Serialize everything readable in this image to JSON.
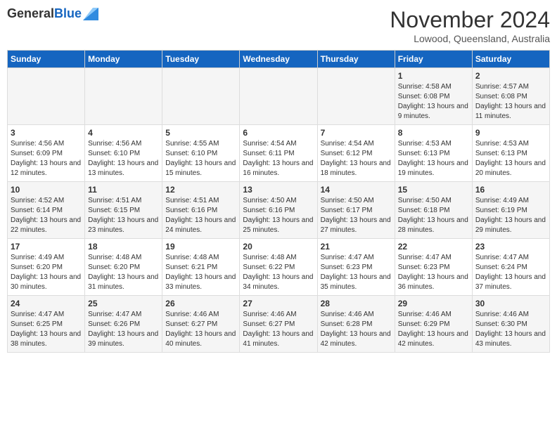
{
  "header": {
    "logo_general": "General",
    "logo_blue": "Blue",
    "month_title": "November 2024",
    "location": "Lowood, Queensland, Australia"
  },
  "weekdays": [
    "Sunday",
    "Monday",
    "Tuesday",
    "Wednesday",
    "Thursday",
    "Friday",
    "Saturday"
  ],
  "weeks": [
    [
      {
        "day": "",
        "info": ""
      },
      {
        "day": "",
        "info": ""
      },
      {
        "day": "",
        "info": ""
      },
      {
        "day": "",
        "info": ""
      },
      {
        "day": "",
        "info": ""
      },
      {
        "day": "1",
        "info": "Sunrise: 4:58 AM\nSunset: 6:08 PM\nDaylight: 13 hours and 9 minutes."
      },
      {
        "day": "2",
        "info": "Sunrise: 4:57 AM\nSunset: 6:08 PM\nDaylight: 13 hours and 11 minutes."
      }
    ],
    [
      {
        "day": "3",
        "info": "Sunrise: 4:56 AM\nSunset: 6:09 PM\nDaylight: 13 hours and 12 minutes."
      },
      {
        "day": "4",
        "info": "Sunrise: 4:56 AM\nSunset: 6:10 PM\nDaylight: 13 hours and 13 minutes."
      },
      {
        "day": "5",
        "info": "Sunrise: 4:55 AM\nSunset: 6:10 PM\nDaylight: 13 hours and 15 minutes."
      },
      {
        "day": "6",
        "info": "Sunrise: 4:54 AM\nSunset: 6:11 PM\nDaylight: 13 hours and 16 minutes."
      },
      {
        "day": "7",
        "info": "Sunrise: 4:54 AM\nSunset: 6:12 PM\nDaylight: 13 hours and 18 minutes."
      },
      {
        "day": "8",
        "info": "Sunrise: 4:53 AM\nSunset: 6:13 PM\nDaylight: 13 hours and 19 minutes."
      },
      {
        "day": "9",
        "info": "Sunrise: 4:53 AM\nSunset: 6:13 PM\nDaylight: 13 hours and 20 minutes."
      }
    ],
    [
      {
        "day": "10",
        "info": "Sunrise: 4:52 AM\nSunset: 6:14 PM\nDaylight: 13 hours and 22 minutes."
      },
      {
        "day": "11",
        "info": "Sunrise: 4:51 AM\nSunset: 6:15 PM\nDaylight: 13 hours and 23 minutes."
      },
      {
        "day": "12",
        "info": "Sunrise: 4:51 AM\nSunset: 6:16 PM\nDaylight: 13 hours and 24 minutes."
      },
      {
        "day": "13",
        "info": "Sunrise: 4:50 AM\nSunset: 6:16 PM\nDaylight: 13 hours and 25 minutes."
      },
      {
        "day": "14",
        "info": "Sunrise: 4:50 AM\nSunset: 6:17 PM\nDaylight: 13 hours and 27 minutes."
      },
      {
        "day": "15",
        "info": "Sunrise: 4:50 AM\nSunset: 6:18 PM\nDaylight: 13 hours and 28 minutes."
      },
      {
        "day": "16",
        "info": "Sunrise: 4:49 AM\nSunset: 6:19 PM\nDaylight: 13 hours and 29 minutes."
      }
    ],
    [
      {
        "day": "17",
        "info": "Sunrise: 4:49 AM\nSunset: 6:20 PM\nDaylight: 13 hours and 30 minutes."
      },
      {
        "day": "18",
        "info": "Sunrise: 4:48 AM\nSunset: 6:20 PM\nDaylight: 13 hours and 31 minutes."
      },
      {
        "day": "19",
        "info": "Sunrise: 4:48 AM\nSunset: 6:21 PM\nDaylight: 13 hours and 33 minutes."
      },
      {
        "day": "20",
        "info": "Sunrise: 4:48 AM\nSunset: 6:22 PM\nDaylight: 13 hours and 34 minutes."
      },
      {
        "day": "21",
        "info": "Sunrise: 4:47 AM\nSunset: 6:23 PM\nDaylight: 13 hours and 35 minutes."
      },
      {
        "day": "22",
        "info": "Sunrise: 4:47 AM\nSunset: 6:23 PM\nDaylight: 13 hours and 36 minutes."
      },
      {
        "day": "23",
        "info": "Sunrise: 4:47 AM\nSunset: 6:24 PM\nDaylight: 13 hours and 37 minutes."
      }
    ],
    [
      {
        "day": "24",
        "info": "Sunrise: 4:47 AM\nSunset: 6:25 PM\nDaylight: 13 hours and 38 minutes."
      },
      {
        "day": "25",
        "info": "Sunrise: 4:47 AM\nSunset: 6:26 PM\nDaylight: 13 hours and 39 minutes."
      },
      {
        "day": "26",
        "info": "Sunrise: 4:46 AM\nSunset: 6:27 PM\nDaylight: 13 hours and 40 minutes."
      },
      {
        "day": "27",
        "info": "Sunrise: 4:46 AM\nSunset: 6:27 PM\nDaylight: 13 hours and 41 minutes."
      },
      {
        "day": "28",
        "info": "Sunrise: 4:46 AM\nSunset: 6:28 PM\nDaylight: 13 hours and 42 minutes."
      },
      {
        "day": "29",
        "info": "Sunrise: 4:46 AM\nSunset: 6:29 PM\nDaylight: 13 hours and 42 minutes."
      },
      {
        "day": "30",
        "info": "Sunrise: 4:46 AM\nSunset: 6:30 PM\nDaylight: 13 hours and 43 minutes."
      }
    ]
  ]
}
